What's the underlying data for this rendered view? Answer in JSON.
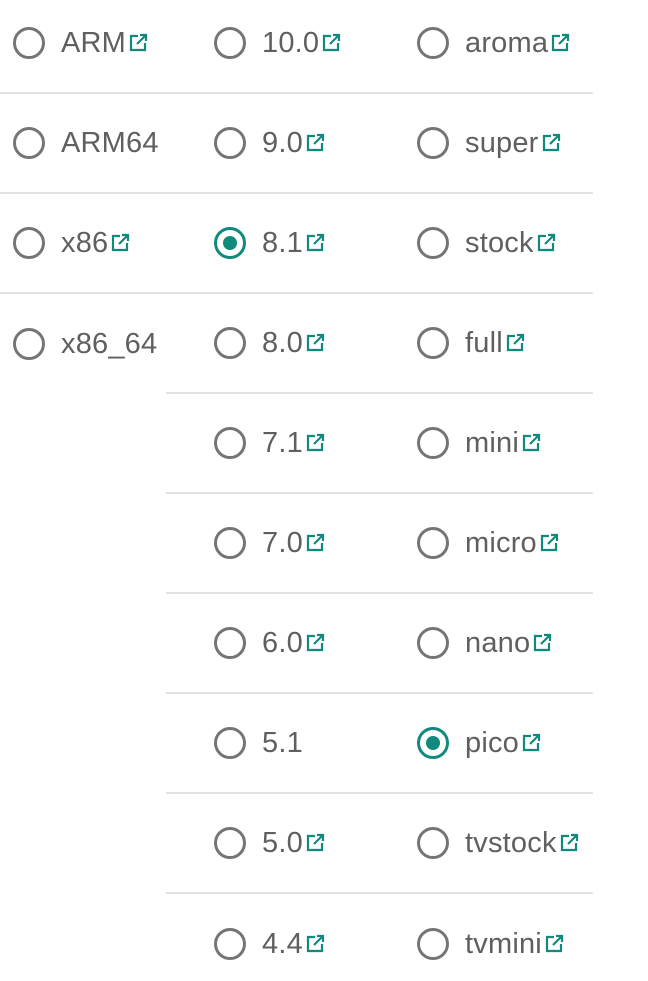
{
  "colors": {
    "accent": "#0f8a7d",
    "radio_border": "#757575",
    "text": "#5f5f5f",
    "divider": "#e2e2e2"
  },
  "icons": {
    "external": "external-link-icon",
    "radio": "radio-button"
  },
  "groups": [
    {
      "name": "platform",
      "options": [
        {
          "label": "ARM",
          "checked": true,
          "link": true
        },
        {
          "label": "ARM64",
          "checked": false,
          "link": false
        },
        {
          "label": "x86",
          "checked": false,
          "link": true
        },
        {
          "label": "x86_64",
          "checked": false,
          "link": false
        }
      ]
    },
    {
      "name": "android",
      "options": [
        {
          "label": "10.0",
          "checked": false,
          "link": true
        },
        {
          "label": "9.0",
          "checked": false,
          "link": true
        },
        {
          "label": "8.1",
          "checked": true,
          "link": true
        },
        {
          "label": "8.0",
          "checked": false,
          "link": true
        },
        {
          "label": "7.1",
          "checked": false,
          "link": true
        },
        {
          "label": "7.0",
          "checked": false,
          "link": true
        },
        {
          "label": "6.0",
          "checked": false,
          "link": true
        },
        {
          "label": "5.1",
          "checked": false,
          "link": false
        },
        {
          "label": "5.0",
          "checked": false,
          "link": true
        },
        {
          "label": "4.4",
          "checked": false,
          "link": true
        }
      ]
    },
    {
      "name": "variant",
      "options": [
        {
          "label": "aroma",
          "checked": false,
          "link": true
        },
        {
          "label": "super",
          "checked": false,
          "link": true
        },
        {
          "label": "stock",
          "checked": false,
          "link": true
        },
        {
          "label": "full",
          "checked": false,
          "link": true
        },
        {
          "label": "mini",
          "checked": false,
          "link": true
        },
        {
          "label": "micro",
          "checked": false,
          "link": true
        },
        {
          "label": "nano",
          "checked": false,
          "link": true
        },
        {
          "label": "pico",
          "checked": true,
          "link": true
        },
        {
          "label": "tvstock",
          "checked": false,
          "link": true
        },
        {
          "label": "tvmini",
          "checked": false,
          "link": true
        }
      ]
    }
  ]
}
